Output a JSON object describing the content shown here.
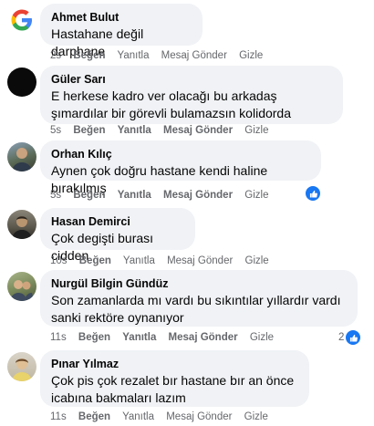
{
  "actions": {
    "like": "Beğen",
    "reply": "Yanıtla",
    "send_message": "Mesaj Gönder",
    "hide": "Gizle"
  },
  "comments": [
    {
      "author": "Ahmet Bulut",
      "text": "Hastahane değil darphane",
      "time": "2s",
      "avatar": "google-logo",
      "reactions": ""
    },
    {
      "author": "Güler Sarı",
      "text": "E herkese kadro ver olacağı bu arkadaş şımardılar bir görevli bulamazsın kolidorda",
      "time": "5s",
      "avatar": "black-circle",
      "reactions": ""
    },
    {
      "author": "Orhan Kılıç",
      "text": "Aynen çok doğru hastane kendi haline bırakılmış",
      "time": "5s",
      "avatar": "profile-photo",
      "reactions": ""
    },
    {
      "author": "Hasan Demirci",
      "text": "Çok degişti burası cidden",
      "time": "10s",
      "avatar": "profile-photo",
      "reactions": ""
    },
    {
      "author": "Nurgül Bilgin Gündüz",
      "text": "Son zamanlarda mı vardı bu sıkıntılar yıllardır vardı sanki rektöre oynanıyor",
      "time": "11s",
      "avatar": "profile-photo",
      "reactions": "2"
    },
    {
      "author": "Pınar Yılmaz",
      "text": "Çok pis çok rezalet bır hastane bır an önce icabına bakmaları lazım",
      "time": "11s",
      "avatar": "profile-photo",
      "reactions": ""
    }
  ],
  "colors": {
    "bubble": "#f0f2f5",
    "meta": "#65676b",
    "like_blue": "#1877f2"
  }
}
